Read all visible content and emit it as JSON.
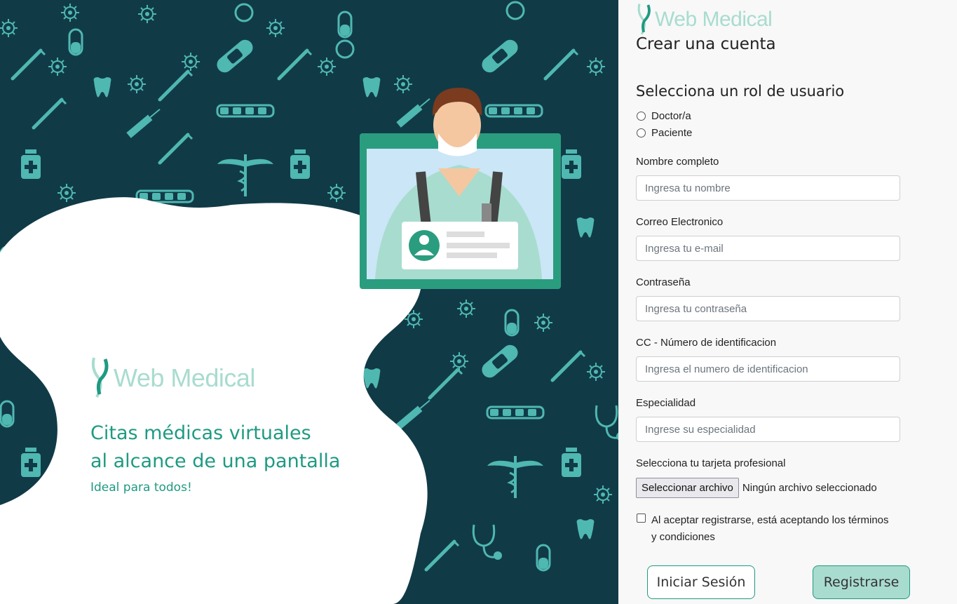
{
  "hero": {
    "brand": "Web Medical",
    "title_line1": "Citas médicas virtuales",
    "title_line2": "al alcance de una pantalla",
    "subtitle": "Ideal para todos!"
  },
  "panel": {
    "brand": "Web Medical",
    "title": "Crear una cuenta",
    "role_heading": "Selecciona un rol de usuario",
    "roles": [
      "Doctor/a",
      "Paciente"
    ],
    "fields": {
      "name": {
        "label": "Nombre completo",
        "placeholder": "Ingresa tu nombre"
      },
      "email": {
        "label": "Correo Electronico",
        "placeholder": "Ingresa tu e-mail"
      },
      "password": {
        "label": "Contraseña",
        "placeholder": "Ingresa tu contraseña"
      },
      "id": {
        "label": "CC - Número de identificacion",
        "placeholder": "Ingresa el numero de identificacion"
      },
      "specialty": {
        "label": "Especialidad",
        "placeholder": "Ingrese su especialidad"
      }
    },
    "file": {
      "label": "Selecciona tu tarjeta profesional",
      "button": "Seleccionar archivo",
      "status": "Ningún archivo seleccionado"
    },
    "terms_line1": "Al aceptar registrarse, está aceptando los términos",
    "terms_line2": "y condiciones",
    "login_button": "Iniciar Sesión",
    "register_button": "Registrarse"
  },
  "colors": {
    "hero_bg": "#113a47",
    "icon_teal": "#4fb8b0",
    "brand_light": "#a8dccf",
    "brand_green": "#1f9a82"
  }
}
